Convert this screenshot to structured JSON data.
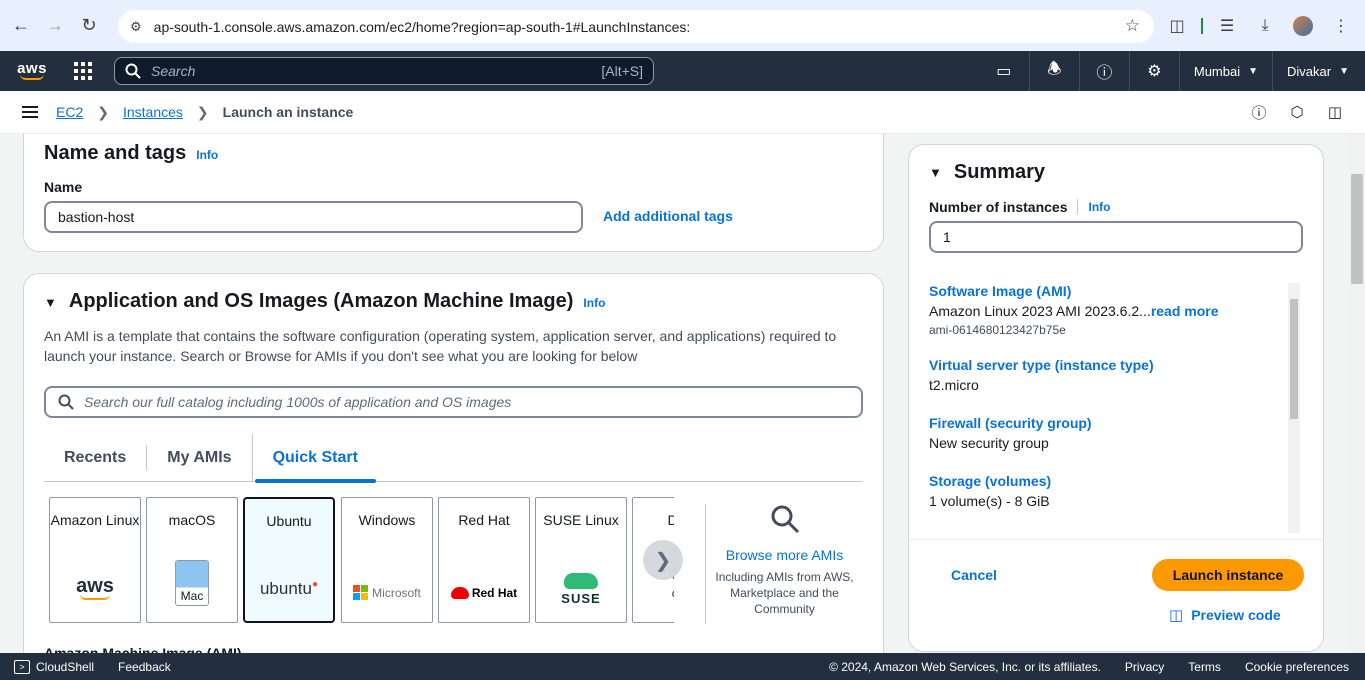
{
  "browser": {
    "url": "ap-south-1.console.aws.amazon.com/ec2/home?region=ap-south-1#LaunchInstances:"
  },
  "aws_nav": {
    "logo": "aws",
    "search_placeholder": "Search",
    "search_shortcut": "[Alt+S]",
    "region": "Mumbai",
    "user": "Divakar"
  },
  "breadcrumb": {
    "items": [
      "EC2",
      "Instances",
      "Launch an instance"
    ]
  },
  "name_tags": {
    "title": "Name and tags",
    "info": "Info",
    "name_label": "Name",
    "name_value": "bastion-host",
    "add_tags": "Add additional tags"
  },
  "ami": {
    "title": "Application and OS Images (Amazon Machine Image)",
    "info": "Info",
    "description": "An AMI is a template that contains the software configuration (operating system, application server, and applications) required to launch your instance. Search or Browse for AMIs if you don't see what you are looking for below",
    "search_placeholder": "Search our full catalog including 1000s of application and OS images",
    "tabs": [
      "Recents",
      "My AMIs",
      "Quick Start"
    ],
    "active_tab": "Quick Start",
    "tiles": [
      {
        "name": "Amazon Linux",
        "logo": "aws"
      },
      {
        "name": "macOS",
        "logo": "Mac"
      },
      {
        "name": "Ubuntu",
        "logo": "ubuntu"
      },
      {
        "name": "Windows",
        "logo": "Microsoft"
      },
      {
        "name": "Red Hat",
        "logo": "Red Hat"
      },
      {
        "name": "SUSE Linux",
        "logo": "SUSE"
      },
      {
        "name": "Del",
        "logo": "de"
      }
    ],
    "selected_tile": "Ubuntu",
    "browse_link": "Browse more AMIs",
    "browse_sub": "Including AMIs from AWS, Marketplace and the Community",
    "next_heading": "Amazon Machine Image (AMI)"
  },
  "summary": {
    "title": "Summary",
    "instances_label": "Number of instances",
    "info": "Info",
    "instances_value": "1",
    "rows": [
      {
        "title": "Software Image (AMI)",
        "value": "Amazon Linux 2023 AMI 2023.6.2...",
        "more": "read more",
        "sub": "ami-0614680123427b75e"
      },
      {
        "title": "Virtual server type (instance type)",
        "value": "t2.micro"
      },
      {
        "title": "Firewall (security group)",
        "value": "New security group"
      },
      {
        "title": "Storage (volumes)",
        "value": "1 volume(s) - 8 GiB"
      }
    ],
    "cancel": "Cancel",
    "launch": "Launch instance",
    "preview": "Preview code"
  },
  "footer": {
    "cloudshell": "CloudShell",
    "feedback": "Feedback",
    "copyright": "© 2024, Amazon Web Services, Inc. or its affiliates.",
    "privacy": "Privacy",
    "terms": "Terms",
    "cookies": "Cookie preferences"
  }
}
